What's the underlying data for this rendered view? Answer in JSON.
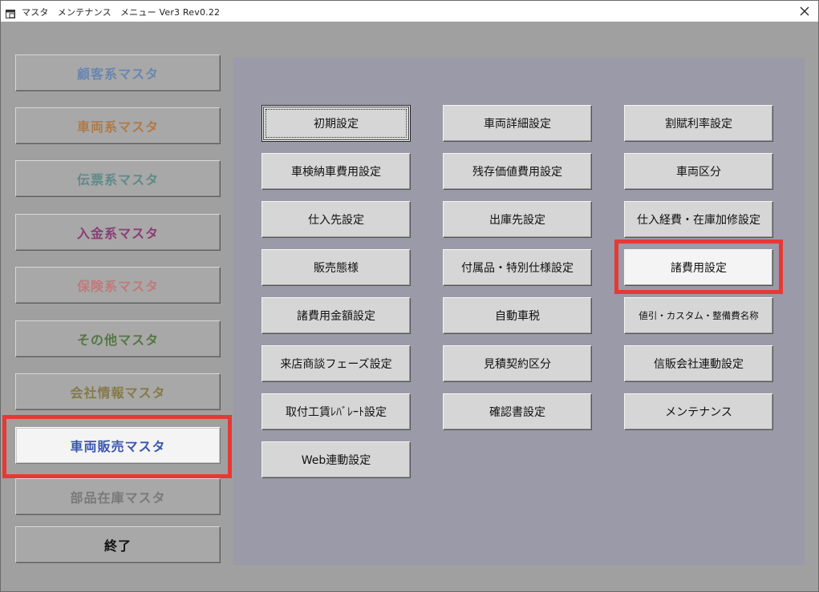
{
  "window": {
    "title": "マスタ　メンテナンス　メニュー Ver3 Rev0.22"
  },
  "left_menu": {
    "items": [
      {
        "label": "顧客系マスタ",
        "color": "#6a86b0"
      },
      {
        "label": "車両系マスタ",
        "color": "#b07a48"
      },
      {
        "label": "伝票系マスタ",
        "color": "#5f8a88"
      },
      {
        "label": "入金系マスタ",
        "color": "#8a3e74"
      },
      {
        "label": "保険系マスタ",
        "color": "#c07a7a"
      },
      {
        "label": "その他マスタ",
        "color": "#557744"
      },
      {
        "label": "会社情報マスタ",
        "color": "#857a4a"
      },
      {
        "label": "車両販売マスタ",
        "color": "#3a56b0"
      },
      {
        "label": "部品在庫マスタ",
        "color": "#7a7a7a"
      },
      {
        "label": "終了",
        "color": "#111111"
      }
    ],
    "selected_index": 7
  },
  "panel": {
    "buttons": [
      {
        "label": "初期設定"
      },
      {
        "label": "車両詳細設定"
      },
      {
        "label": "割賦利率設定"
      },
      {
        "label": "車検納車費用設定"
      },
      {
        "label": "残存価値費用設定"
      },
      {
        "label": "車両区分"
      },
      {
        "label": "仕入先設定"
      },
      {
        "label": "出庫先設定"
      },
      {
        "label": "仕入経費・在庫加修設定"
      },
      {
        "label": "販売態様"
      },
      {
        "label": "付属品・特別仕様設定"
      },
      {
        "label": "諸費用設定"
      },
      {
        "label": "諸費用金額設定"
      },
      {
        "label": "自動車税"
      },
      {
        "label": "値引・カスタム・整備費名称"
      },
      {
        "label": "来店商談フェーズ設定"
      },
      {
        "label": "見積契約区分"
      },
      {
        "label": "信販会社連動設定"
      },
      {
        "label": "取付工賃ﾚﾊﾞﾚｰﾄ設定"
      },
      {
        "label": "確認書設定"
      },
      {
        "label": "メンテナンス"
      },
      {
        "label": "Web連動設定"
      }
    ]
  }
}
